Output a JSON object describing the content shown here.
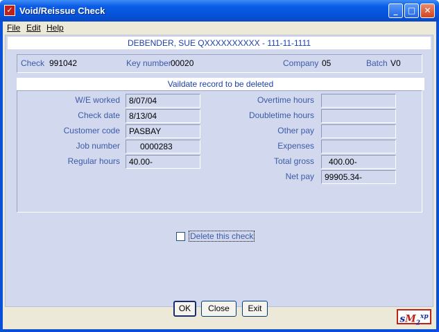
{
  "window": {
    "title": "Void/Reissue Check",
    "icon": "sm-app-icon"
  },
  "menu": {
    "items": [
      "File",
      "Edit",
      "Help"
    ]
  },
  "employee_banner": "DEBENDER, SUE QXXXXXXXXXX  -  111-11-1111",
  "info": {
    "check_label": "Check",
    "check_value": "991042",
    "key_label": "Key number",
    "key_value": "00020",
    "company_label": "Company",
    "company_value": "05",
    "batch_label": "Batch",
    "batch_value": "V0"
  },
  "section_title": "Vaildate record to be deleted",
  "left_fields": [
    {
      "label": "W/E worked",
      "value": "8/07/04"
    },
    {
      "label": "Check date",
      "value": "8/13/04"
    },
    {
      "label": "Customer code",
      "value": "PASBAY"
    },
    {
      "label": "Job number",
      "value": "0000283"
    },
    {
      "label": "Regular hours",
      "value": "40.00-"
    }
  ],
  "right_fields": [
    {
      "label": "Overtime hours",
      "value": ""
    },
    {
      "label": "Doubletime hours",
      "value": ""
    },
    {
      "label": "Other pay",
      "value": ""
    },
    {
      "label": "Expenses",
      "value": ""
    },
    {
      "label": "Total gross",
      "value": "400.00-"
    },
    {
      "label": "Net pay",
      "value": "99905.34-"
    }
  ],
  "delete_checkbox": {
    "label": "Delete this check",
    "checked": false
  },
  "buttons": {
    "ok": "OK",
    "close": "Close",
    "exit": "Exit"
  },
  "logo": {
    "s": "s",
    "m": "M",
    "two": "2",
    "xp": "xp"
  },
  "colors": {
    "title_bar": "#0a5be6",
    "panel": "#d2d9ef",
    "label_blue": "#3b5aa6"
  }
}
